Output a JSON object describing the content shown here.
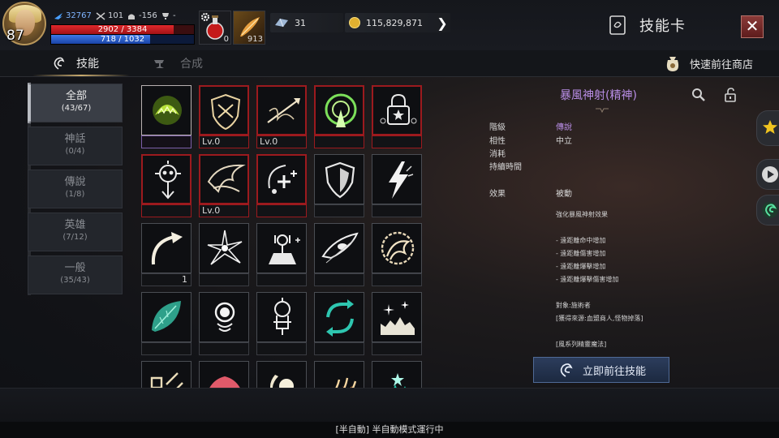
{
  "player": {
    "level": "87",
    "power": "32767",
    "attack_stat": "101",
    "defense_stat": "-156",
    "trophy_stat": "-",
    "hp": "2902 / 3384",
    "hp_fraction": 0.858,
    "mp": "718 / 1032",
    "mp_fraction": 0.696
  },
  "quick_slots": [
    {
      "icon": "potion-icon",
      "count": "0"
    },
    {
      "icon": "feather-scroll-icon",
      "count": "913"
    }
  ],
  "resources": {
    "crystal": "31",
    "gold": "115,829,871"
  },
  "header": {
    "title": "技能卡",
    "close_icon": "close-icon"
  },
  "tabs": [
    {
      "label": "技能",
      "active": true
    },
    {
      "label": "合成",
      "active": false
    }
  ],
  "shop_link": "快速前往商店",
  "categories": [
    {
      "name": "全部",
      "count": "(43/67)",
      "selected": true
    },
    {
      "name": "神話",
      "count": "(0/4)",
      "selected": false
    },
    {
      "name": "傳說",
      "count": "(1/8)",
      "selected": false
    },
    {
      "name": "英雄",
      "count": "(7/12)",
      "selected": false
    },
    {
      "name": "一般",
      "count": "(35/43)",
      "selected": false
    }
  ],
  "skills": [
    {
      "icon": "venus-flytrap-icon",
      "label": "",
      "style": "sel"
    },
    {
      "icon": "crossbow-shield-icon",
      "label": "Lv.0",
      "style": "red"
    },
    {
      "icon": "shadow-arrow-icon",
      "label": "Lv.0",
      "style": "red"
    },
    {
      "icon": "aura-tower-icon",
      "label": "",
      "style": "red"
    },
    {
      "icon": "star-lock-icon",
      "label": "",
      "style": "red"
    },
    {
      "icon": "skull-target-icon",
      "label": "",
      "style": "red"
    },
    {
      "icon": "winged-bow-icon",
      "label": "Lv.0",
      "style": "red"
    },
    {
      "icon": "heal-plus-icon",
      "label": "",
      "style": "red"
    },
    {
      "icon": "shield-crest-icon",
      "label": "",
      "style": "normal"
    },
    {
      "icon": "lightning-bolt-icon",
      "label": "",
      "style": "normal"
    },
    {
      "icon": "curved-arrow-icon",
      "label": "1",
      "style": "normal"
    },
    {
      "icon": "burst-spark-icon",
      "label": "",
      "style": "normal"
    },
    {
      "icon": "arrow-rain-icon",
      "label": "",
      "style": "normal"
    },
    {
      "icon": "eagle-eye-icon",
      "label": "",
      "style": "normal"
    },
    {
      "icon": "dragon-head-icon",
      "label": "",
      "style": "normal"
    },
    {
      "icon": "green-leaf-icon",
      "label": "",
      "style": "normal"
    },
    {
      "icon": "orb-stand-icon",
      "label": "",
      "style": "normal"
    },
    {
      "icon": "spirit-totem-icon",
      "label": "",
      "style": "normal"
    },
    {
      "icon": "cycle-arrows-icon",
      "label": "",
      "style": "normal"
    },
    {
      "icon": "city-sparkle-icon",
      "label": "",
      "style": "normal"
    },
    {
      "icon": "trap-chain-icon",
      "label": "",
      "style": "normal"
    },
    {
      "icon": "bat-wing-icon",
      "label": "",
      "style": "normal"
    },
    {
      "icon": "moon-orb-icon",
      "label": "",
      "style": "normal"
    },
    {
      "icon": "fire-claw-icon",
      "label": "",
      "style": "normal"
    },
    {
      "icon": "teal-burst-icon",
      "label": "",
      "style": "normal"
    }
  ],
  "detail": {
    "name": "暴風神射(精神)",
    "rows": [
      {
        "key": "階級",
        "value": "傳說",
        "legend": true
      },
      {
        "key": "相性",
        "value": "中立",
        "legend": false
      },
      {
        "key": "消耗",
        "value": "",
        "legend": false
      },
      {
        "key": "持續時間",
        "value": "",
        "legend": false
      }
    ],
    "effect_key": "效果",
    "effect_value": "被動",
    "desc_lines": [
      "強化暴風神射效果",
      "",
      "- 遠距離命中增加",
      "- 遠距離傷害增加",
      "- 遠距離爆擊增加",
      "- 遠距離爆擊傷害增加",
      "",
      "對象:施術者",
      "[獲得來源:血盟商人,怪物掉落]",
      "",
      "[風系列精靈魔法]"
    ],
    "goto_button": "立即前往技能"
  },
  "status_message": "[半自動] 半自動模式運行中",
  "colors": {
    "legend_purple": "#b98ee6",
    "owned_red": "#9c1a1e",
    "accent_gold": "#c8aa6e"
  }
}
